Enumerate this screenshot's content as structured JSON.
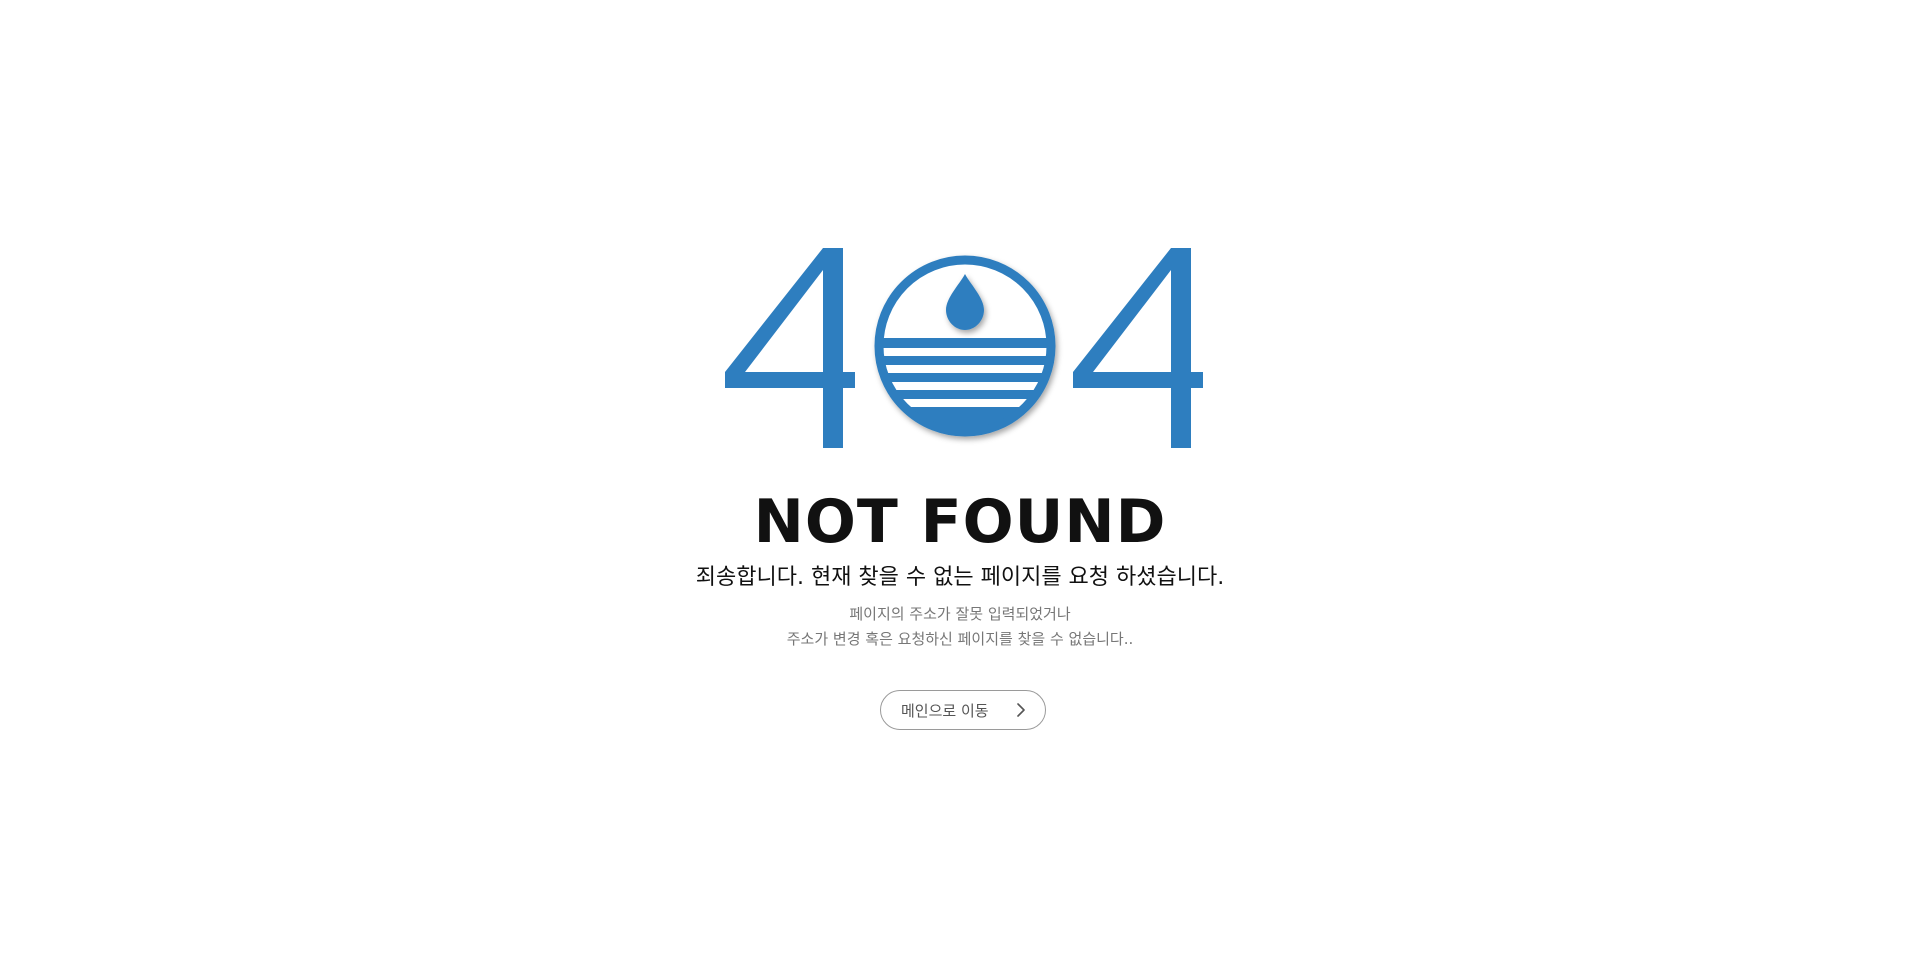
{
  "error": {
    "code_left_digit": "4",
    "code_right_digit": "4",
    "brand_color": "#2e7ebf",
    "emblem_icon": "water-drop-emblem-icon"
  },
  "title": "NOT FOUND",
  "subtitle": "죄송합니다. 현재 찾을 수 없는 페이지를 요청 하셨습니다.",
  "description": {
    "line1": "페이지의 주소가 잘못 입력되었거나",
    "line2": "주소가 변경 혹은 요청하신 페이지를 찾을 수 없습니다.."
  },
  "home_button": {
    "label": "메인으로 이동",
    "icon": "chevron-right-icon"
  }
}
